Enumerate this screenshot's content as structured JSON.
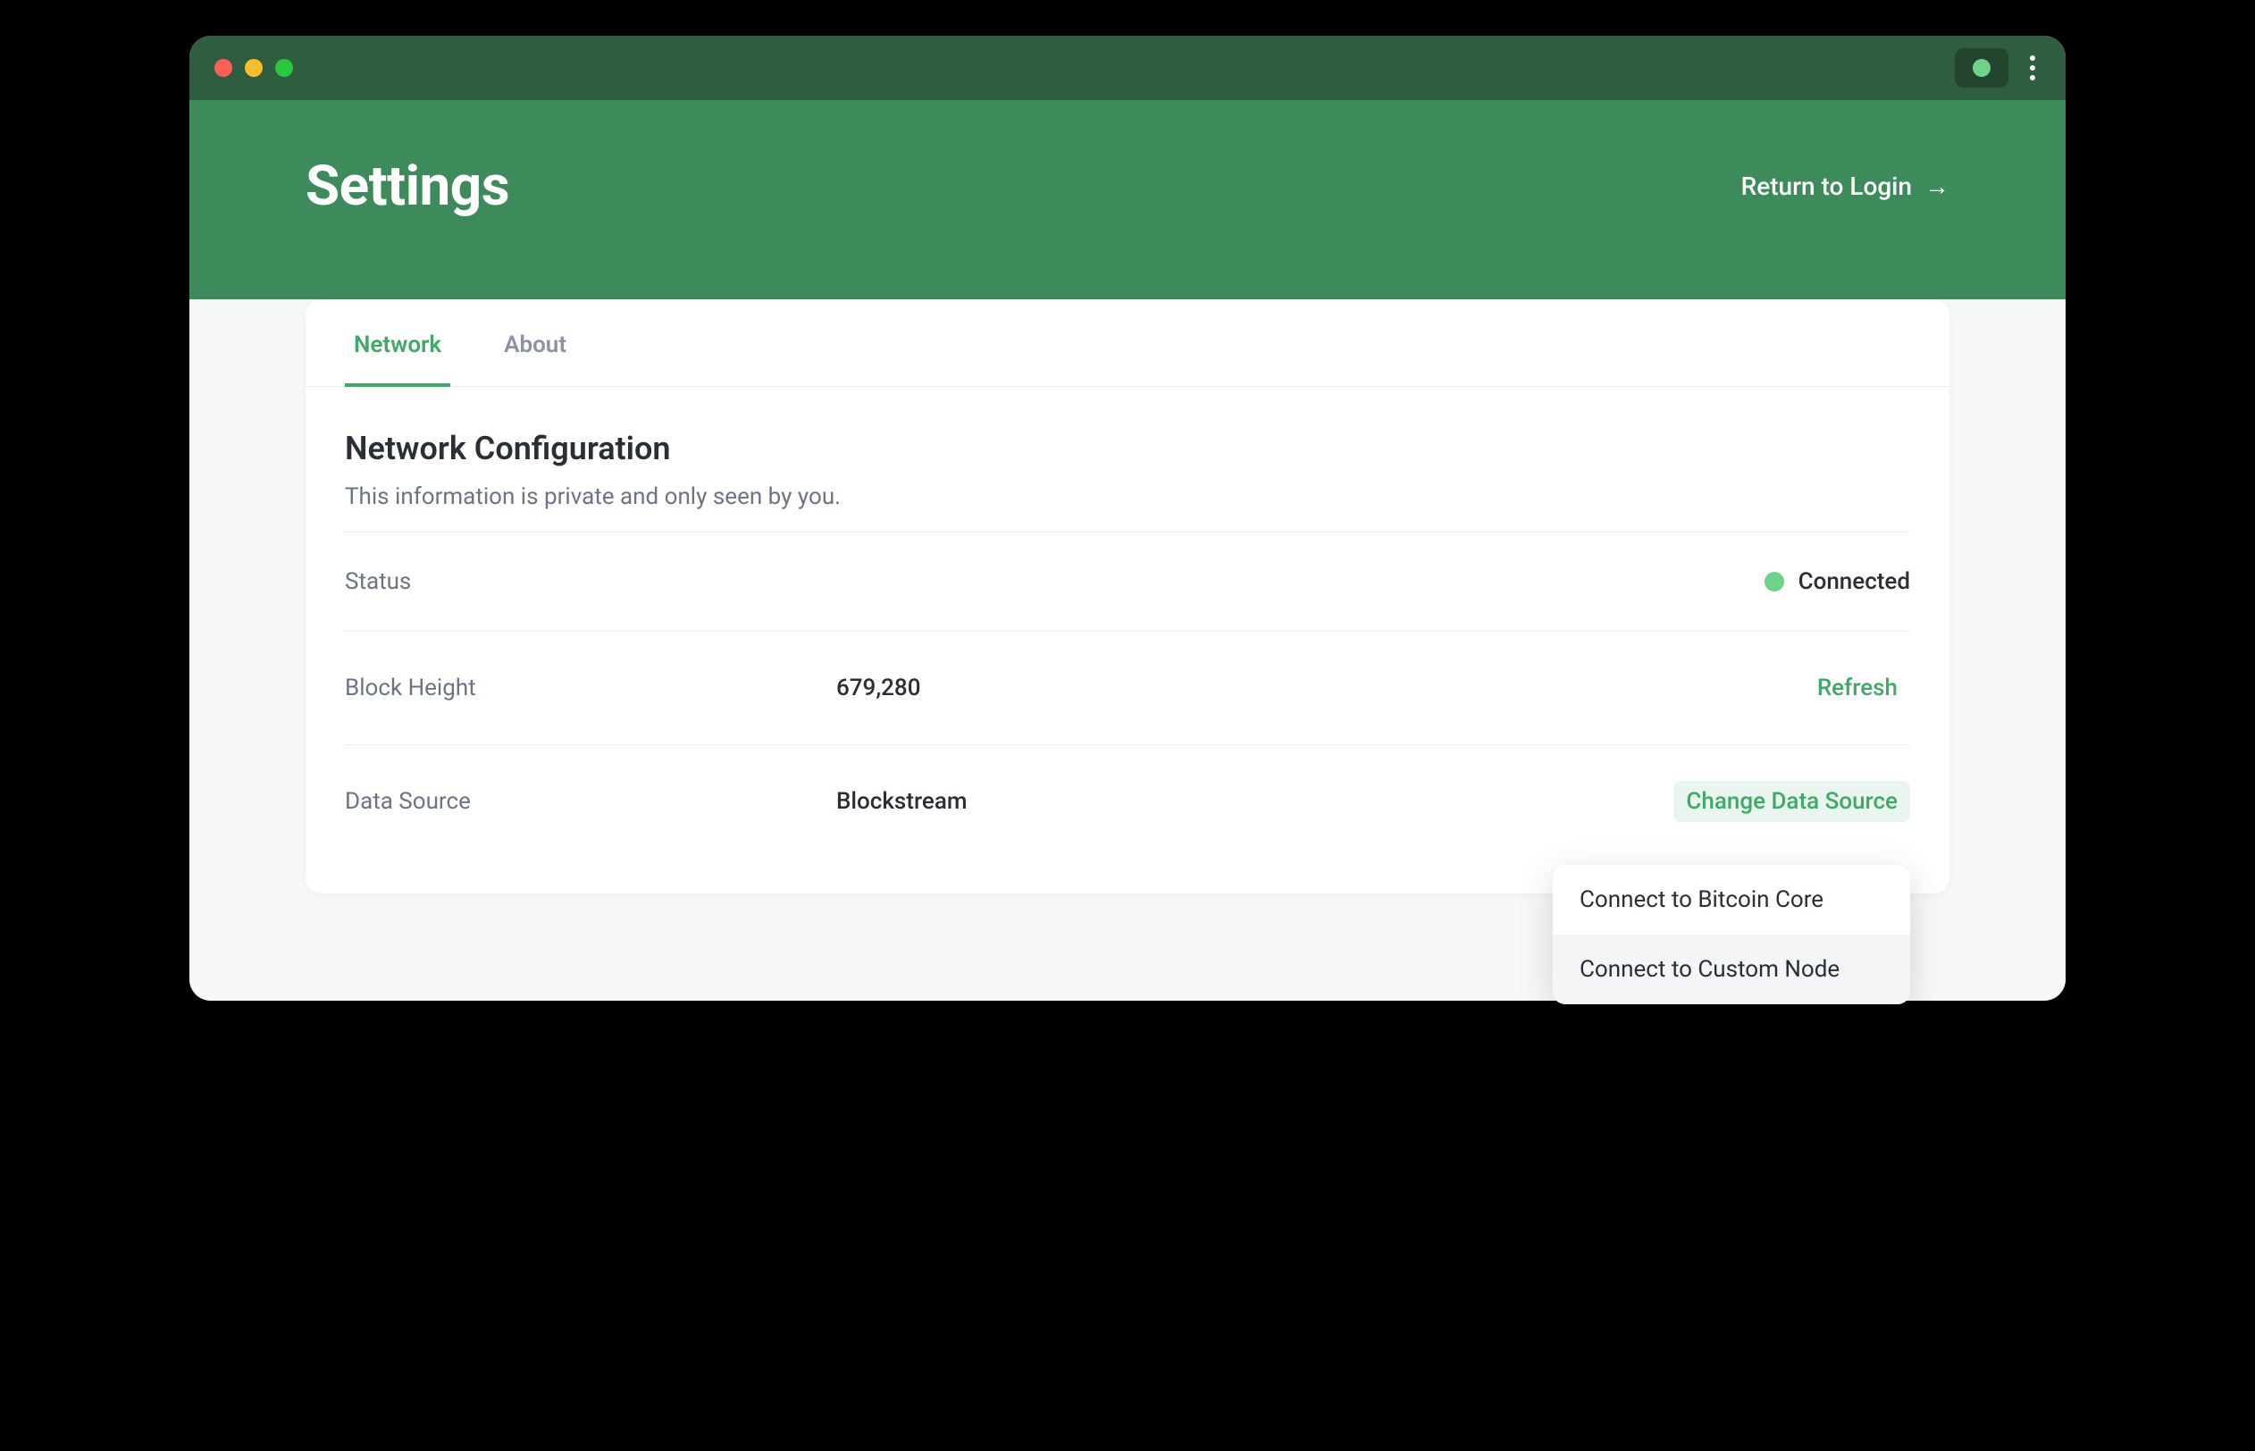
{
  "header": {
    "title": "Settings",
    "return_label": "Return to Login"
  },
  "tabs": {
    "network": "Network",
    "about": "About"
  },
  "section": {
    "title": "Network Configuration",
    "subtitle": "This information is private and only seen by you."
  },
  "rows": {
    "status": {
      "label": "Status",
      "value": "Connected"
    },
    "block_height": {
      "label": "Block Height",
      "value": "679,280",
      "action": "Refresh"
    },
    "data_source": {
      "label": "Data Source",
      "value": "Blockstream",
      "action": "Change Data Source"
    }
  },
  "dropdown": {
    "item1": "Connect to Bitcoin Core",
    "item2": "Connect to Custom Node"
  },
  "colors": {
    "primary_green": "#3d8a5a",
    "dark_green": "#2f5d3f",
    "accent_green": "#3fa968",
    "status_green": "#6dd28a"
  }
}
